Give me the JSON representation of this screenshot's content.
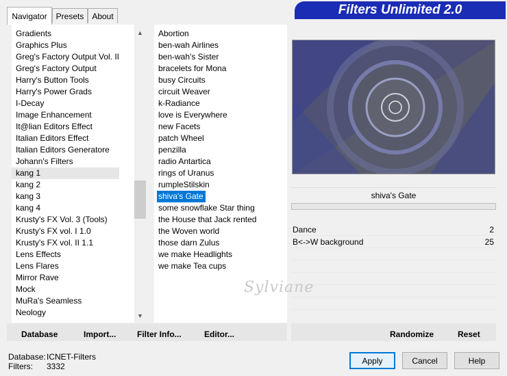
{
  "tabs": [
    "Navigator",
    "Presets",
    "About"
  ],
  "title": "Filters Unlimited 2.0",
  "categories": [
    "Gradients",
    "Graphics Plus",
    "Greg's Factory Output Vol. II",
    "Greg's Factory Output",
    "Harry's Button Tools",
    "Harry's Power Grads",
    "I-Decay",
    "Image Enhancement",
    "It@lian Editors Effect",
    "Italian Editors Effect",
    "Italian Editors Generatore",
    "Johann's Filters",
    "kang 1",
    "kang 2",
    "kang 3",
    "kang 4",
    "Krusty's FX Vol. 3 (Tools)",
    "Krusty's FX vol. I 1.0",
    "Krusty's FX vol. II 1.1",
    "Lens Effects",
    "Lens Flares",
    "Mirror Rave",
    "Mock",
    "MuRa's Seamless",
    "Neology"
  ],
  "filters": [
    "Abortion",
    "ben-wah Airlines",
    "ben-wah's Sister",
    "bracelets for Mona",
    "busy Circuits",
    "circuit Weaver",
    "k-Radiance",
    "love is Everywhere",
    "new Facets",
    "patch Wheel",
    "penzilla",
    "radio Antartica",
    "rings of Uranus",
    "rumpleStilskin",
    "shiva's Gate",
    "some snowflake Star thing",
    "the House that Jack rented",
    "the Woven world",
    "those darn Zulus",
    "we make Headlights",
    "we make Tea cups"
  ],
  "selected_filter": "shiva's Gate",
  "params": [
    {
      "label": "Dance",
      "value": "2"
    },
    {
      "label": "B<->W background",
      "value": "25"
    }
  ],
  "toolbar": {
    "database": "Database",
    "import": "Import...",
    "filter_info": "Filter Info...",
    "editor": "Editor...",
    "randomize": "Randomize",
    "reset": "Reset"
  },
  "buttons": {
    "apply": "Apply",
    "cancel": "Cancel",
    "help": "Help"
  },
  "status": {
    "database_label": "Database:",
    "database_value": "ICNET-Filters",
    "filters_label": "Filters:",
    "filters_value": "3332"
  },
  "watermark": "Sylviane",
  "colors": {
    "title_bg": "#1b2db5",
    "selection": "#0078d7"
  }
}
